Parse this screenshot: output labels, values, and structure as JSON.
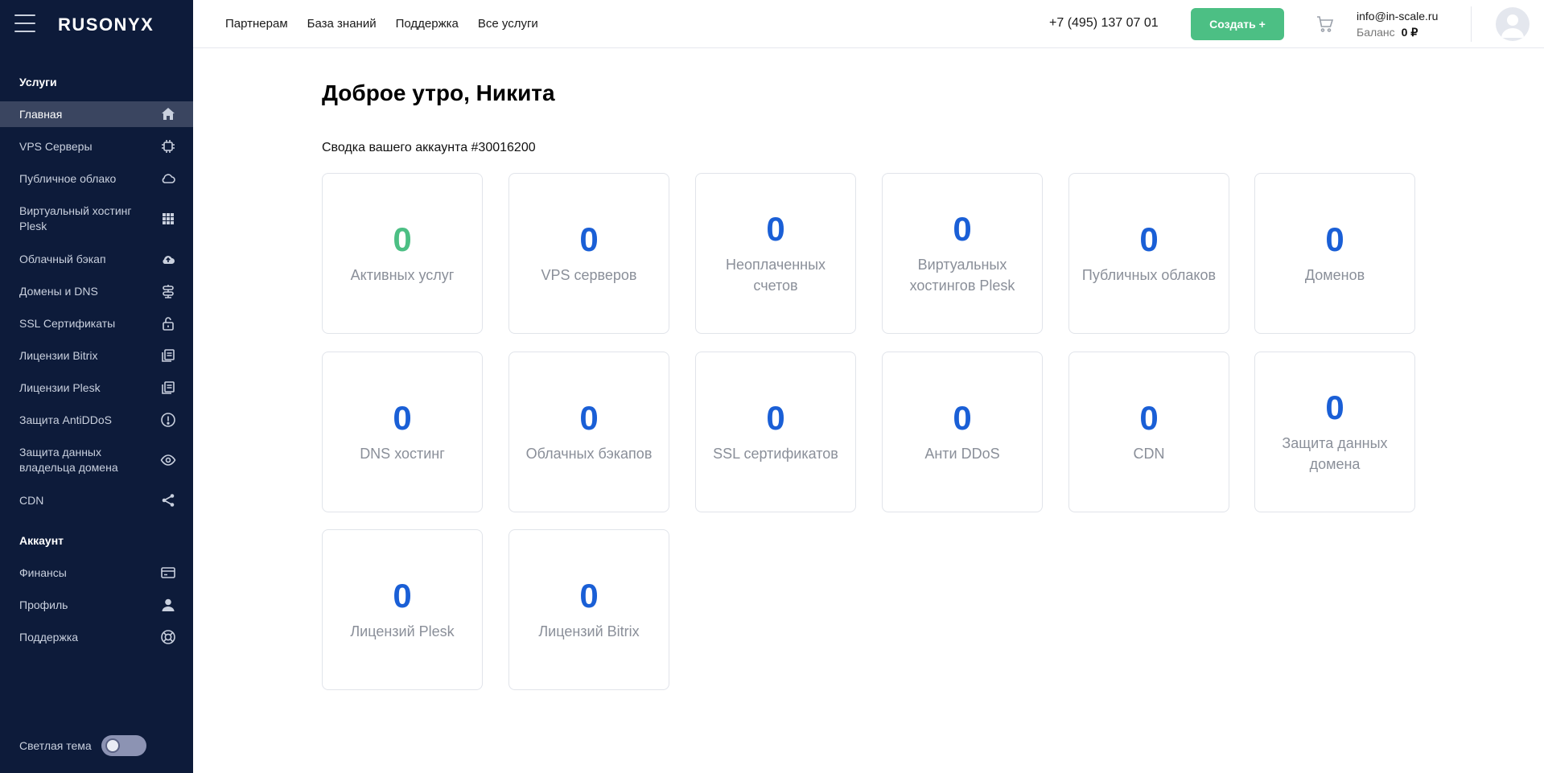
{
  "sidebar": {
    "logo": "RUSONYX",
    "section_services": "Услуги",
    "items": [
      {
        "label": "Главная",
        "icon": "home-icon"
      },
      {
        "label": "VPS Серверы",
        "icon": "chip-icon"
      },
      {
        "label": "Публичное облако",
        "icon": "cloud-icon"
      },
      {
        "label": "Виртуальный хостинг Plesk",
        "icon": "grid-icon"
      },
      {
        "label": "Облачный бэкап",
        "icon": "cloud-upload-icon"
      },
      {
        "label": "Домены и DNS",
        "icon": "dns-icon"
      },
      {
        "label": "SSL Сертификаты",
        "icon": "lock-icon"
      },
      {
        "label": "Лицензии Bitrix",
        "icon": "license-icon"
      },
      {
        "label": "Лицензии Plesk",
        "icon": "license-icon"
      },
      {
        "label": "Защита AntiDDoS",
        "icon": "alert-circle-icon"
      },
      {
        "label": "Защита данных владельца домена",
        "icon": "eye-icon"
      },
      {
        "label": "CDN",
        "icon": "share-icon"
      }
    ],
    "section_account": "Аккаунт",
    "account_items": [
      {
        "label": "Финансы",
        "icon": "card-icon"
      },
      {
        "label": "Профиль",
        "icon": "user-icon"
      },
      {
        "label": "Поддержка",
        "icon": "lifebuoy-icon"
      }
    ],
    "theme_label": "Светлая тема"
  },
  "header": {
    "nav": [
      "Партнерам",
      "База знаний",
      "Поддержка",
      "Все услуги"
    ],
    "phone": "+7 (495) 137 07 01",
    "create_label": "Создать +",
    "email": "info@in-scale.ru",
    "balance_label": "Баланс",
    "balance_value": "0 ₽"
  },
  "main": {
    "greeting": "Доброе утро, Никита",
    "summary": "Сводка вашего аккаунта #30016200",
    "cards": [
      {
        "value": "0",
        "label": "Активных услуг"
      },
      {
        "value": "0",
        "label": "VPS серверов"
      },
      {
        "value": "0",
        "label": "Неоплаченных счетов"
      },
      {
        "value": "0",
        "label": "Виртуальных хостингов Plesk"
      },
      {
        "value": "0",
        "label": "Публичных облаков"
      },
      {
        "value": "0",
        "label": "Доменов"
      },
      {
        "value": "0",
        "label": "DNS хостинг"
      },
      {
        "value": "0",
        "label": "Облачных бэкапов"
      },
      {
        "value": "0",
        "label": "SSL сертификатов"
      },
      {
        "value": "0",
        "label": "Анти DDoS"
      },
      {
        "value": "0",
        "label": "CDN"
      },
      {
        "value": "0",
        "label": "Защита данных домена"
      },
      {
        "value": "0",
        "label": "Лицензий Plesk"
      },
      {
        "value": "0",
        "label": "Лицензий Bitrix"
      }
    ]
  },
  "colors": {
    "sidebar_bg": "#0d1b3a",
    "active_item_bg": "#3a4560",
    "accent_green": "#4cbf84",
    "number_blue": "#1a5fd6"
  }
}
